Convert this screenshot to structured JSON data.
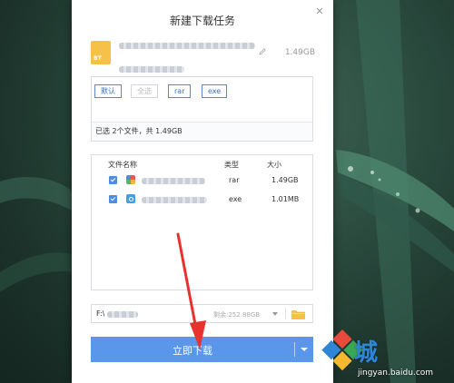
{
  "dialog": {
    "title": "新建下载任务",
    "close_glyph": "✕"
  },
  "task": {
    "icon_tag": "BT",
    "total_size": "1.49GB"
  },
  "filter": {
    "chips": [
      {
        "label": "默认",
        "enabled": true
      },
      {
        "label": "全选",
        "enabled": false
      },
      {
        "label": "rar",
        "enabled": true
      },
      {
        "label": "exe",
        "enabled": true
      }
    ],
    "selected_info": "已选 2个文件，共 1.49GB"
  },
  "table": {
    "headers": {
      "name": "文件名称",
      "type": "类型",
      "size": "大小"
    },
    "rows": [
      {
        "type": "rar",
        "size": "1.49GB",
        "icon": "rar-archive-icon",
        "checked": true
      },
      {
        "type": "exe",
        "size": "1.01MB",
        "icon": "exe-file-icon",
        "checked": true
      }
    ]
  },
  "save_path": {
    "drive": "F:\\",
    "free_space": "剩余:252.88GB"
  },
  "actions": {
    "download_label": "立即下载"
  },
  "watermark": {
    "site": "jingyan.baidu.com",
    "brand_char": "城"
  },
  "colors": {
    "accent": "#5a96ea",
    "chip_border": "#5b87c9",
    "folder": "#f6c148"
  }
}
